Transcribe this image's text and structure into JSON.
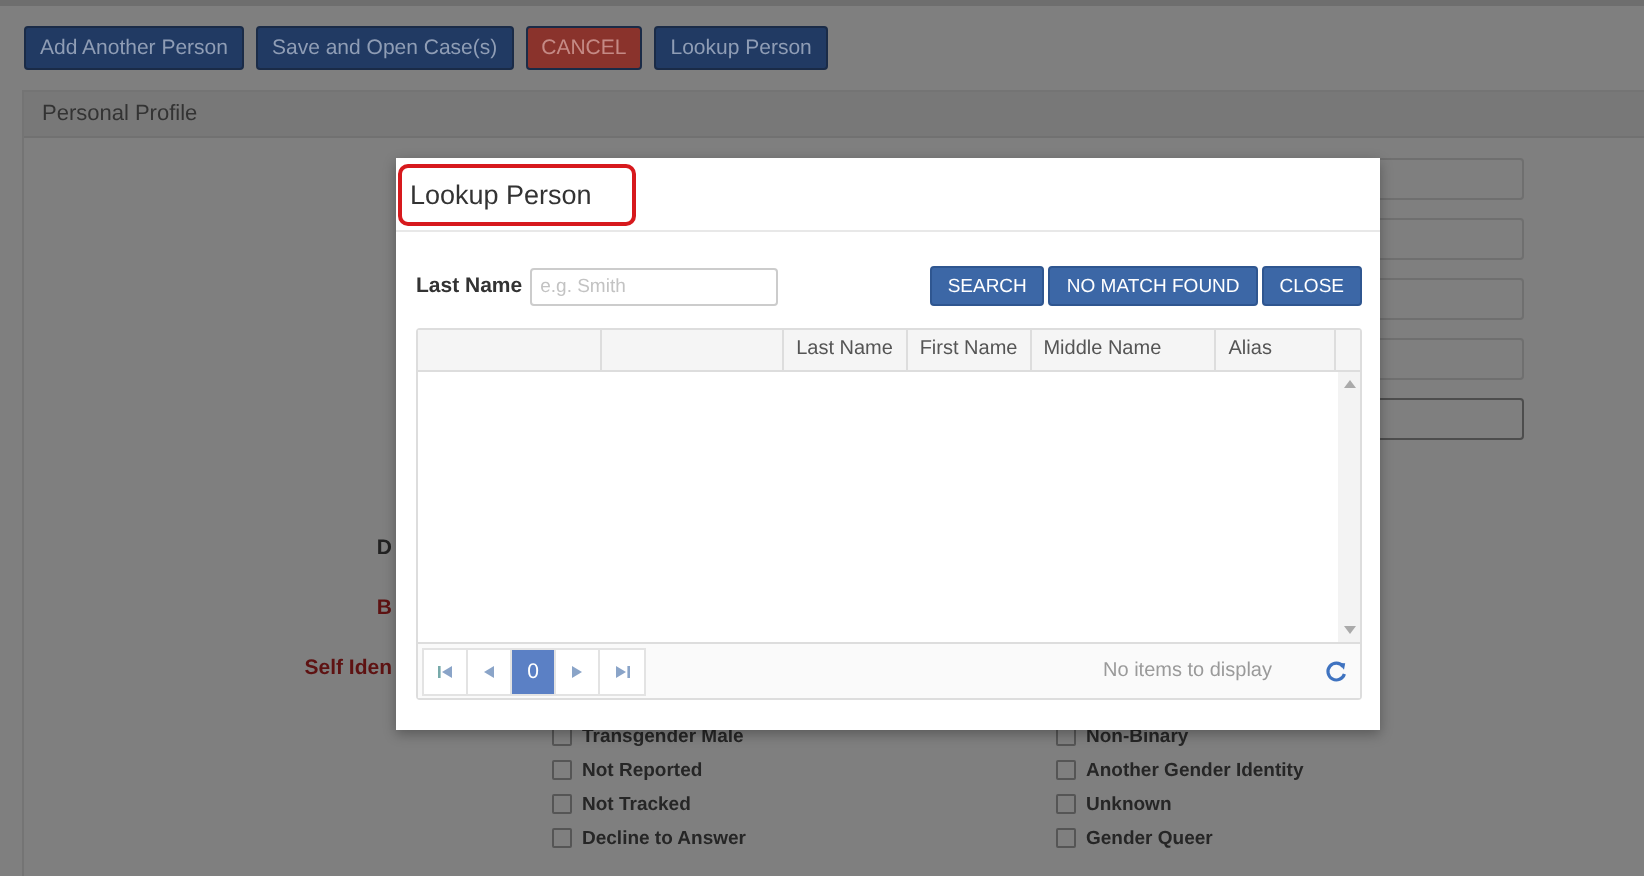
{
  "toolbar": {
    "buttons": [
      {
        "label": "Add Another Person",
        "kind": "primary"
      },
      {
        "label": "Save and Open Case(s)",
        "kind": "primary"
      },
      {
        "label": "CANCEL",
        "kind": "danger"
      },
      {
        "label": "Lookup Person",
        "kind": "primary"
      }
    ]
  },
  "panel": {
    "title": "Personal Profile",
    "form_labels": [
      {
        "text": "D",
        "required": false
      },
      {
        "text": "B",
        "required": true
      },
      {
        "text": "Self Iden",
        "required": true
      }
    ],
    "checkboxes": [
      {
        "label": "Transgender Male",
        "checked": false
      },
      {
        "label": "Non-Binary",
        "checked": false
      },
      {
        "label": "Not Reported",
        "checked": false
      },
      {
        "label": "Another Gender Identity",
        "checked": false
      },
      {
        "label": "Not Tracked",
        "checked": false
      },
      {
        "label": "Unknown",
        "checked": false
      },
      {
        "label": "Decline to Answer",
        "checked": false
      },
      {
        "label": "Gender Queer",
        "checked": false
      }
    ]
  },
  "dialog": {
    "title": "Lookup Person",
    "title_highlighted": true,
    "search": {
      "label": "Last Name",
      "placeholder": "e.g. Smith"
    },
    "buttons": [
      "SEARCH",
      "NO MATCH FOUND",
      "CLOSE"
    ],
    "grid": {
      "columns": [
        "Last Name",
        "First Name",
        "Middle Name",
        "Alias"
      ],
      "pager": {
        "pages": [
          {
            "label": "0",
            "selected": true
          }
        ]
      },
      "status": "No items to display"
    }
  }
}
